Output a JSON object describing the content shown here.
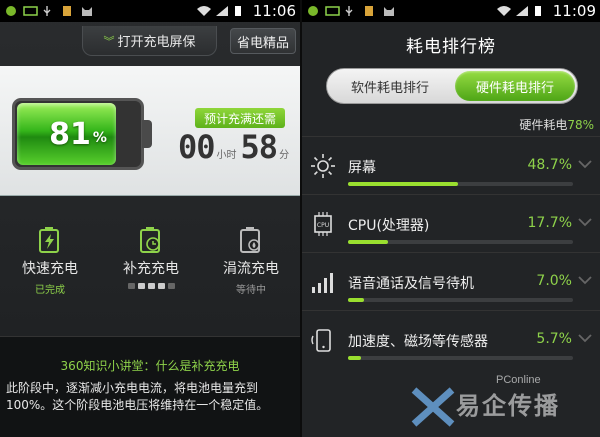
{
  "left": {
    "clock": "11:06",
    "screensaver_label": "打开充电屏保",
    "power_saver_label": "省电精品",
    "battery": {
      "percent_number": "81",
      "percent_sign": "%",
      "level": 0.81
    },
    "eta_label": "预计充满还需",
    "timer": {
      "hours": "00",
      "hours_unit": "小时",
      "minutes": "58",
      "minutes_unit": "分"
    },
    "modes": [
      {
        "label": "快速充电",
        "status": "已完成"
      },
      {
        "label": "补充充电",
        "status": ""
      },
      {
        "label": "涓流充电",
        "status": "等待中"
      }
    ],
    "lecture": {
      "title": "360知识小讲堂：什么是补充充电",
      "body": "此阶段中，逐渐减小充电电流，将电池电量充到100%。这个阶段电池电压将维持在一个稳定值。"
    }
  },
  "right": {
    "clock": "11:09",
    "title": "耗电排行榜",
    "tabs": {
      "software": "软件耗电排行",
      "hardware": "硬件耗电排行"
    },
    "hardware_total_label": "硬件耗电",
    "hardware_total_value": "78%",
    "rows": [
      {
        "name": "屏幕",
        "percent": "48.7%",
        "value": 48.7,
        "icon": "sun-icon"
      },
      {
        "name": "CPU(处理器)",
        "percent": "17.7%",
        "value": 17.7,
        "icon": "cpu-chip-icon"
      },
      {
        "name": "语音通话及信号待机",
        "percent": "7.0%",
        "value": 7.0,
        "icon": "signal-bars-icon"
      },
      {
        "name": "加速度、磁场等传感器",
        "percent": "5.7%",
        "value": 5.7,
        "icon": "phone-sensor-icon"
      }
    ]
  },
  "watermark": {
    "brand": "PConline",
    "text": "易企传播"
  },
  "colors": {
    "accent_green": "#8ed24a",
    "bar_green": "#9adf2f",
    "panel_light": "#eceeef"
  }
}
